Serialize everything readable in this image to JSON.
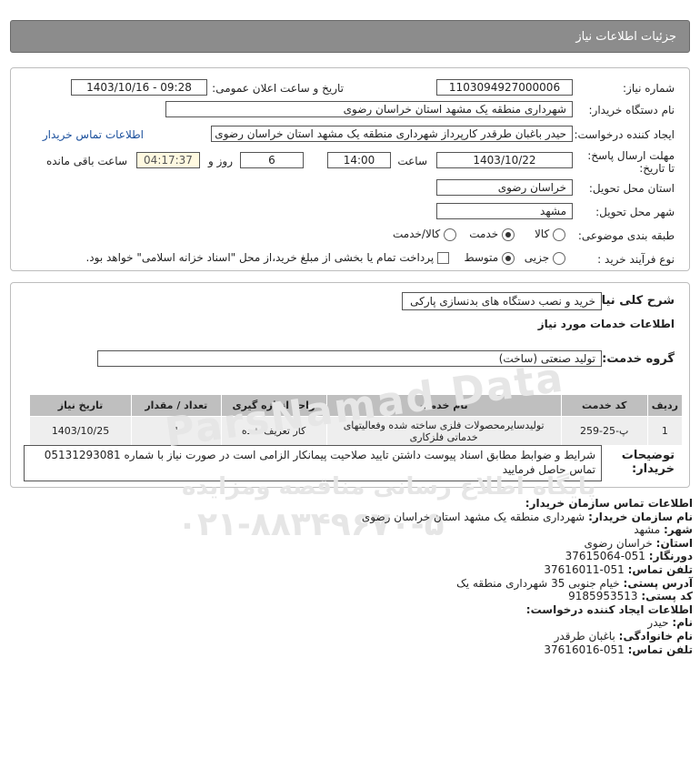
{
  "header": {
    "title": "جزئیات اطلاعات نیاز"
  },
  "info": {
    "need_number_label": "شماره نیاز:",
    "need_number": "1103094927000006",
    "announce_label": "تاریخ و ساعت اعلان عمومی:",
    "announce_value": "1403/10/16 - 09:28",
    "buyer_label": "نام دستگاه خریدار:",
    "buyer": "شهرداری منطقه یک مشهد استان خراسان رضوی",
    "creator_label": "ایجاد کننده درخواست:",
    "creator": "حیدر باغبان طرقدر کارپرداز شهرداری منطقه یک مشهد استان خراسان رضوی",
    "contact_link": "اطلاعات تماس خریدار",
    "deadline_label": "مهلت ارسال پاسخ: تا تاریخ:",
    "deadline_date": "1403/10/22",
    "time_label": "ساعت",
    "deadline_time": "14:00",
    "days_value": "6",
    "days_label": "روز و",
    "remaining_time": "04:17:37",
    "remaining_label": "ساعت باقی مانده",
    "province_label": "استان محل تحویل:",
    "province": "خراسان رضوی",
    "city_label": "شهر محل تحویل:",
    "city": "مشهد",
    "category_label": "طبقه بندی موضوعی:",
    "category_options": [
      "کالا",
      "خدمت",
      "کالا/خدمت"
    ],
    "category_selected": 1,
    "process_label": "نوع فرآیند خرید :",
    "process_options": [
      "جزیی",
      "متوسط"
    ],
    "process_selected": 1,
    "payment_note": "پرداخت تمام یا بخشی از مبلغ خرید،از محل \"اسناد خزانه اسلامی\" خواهد بود."
  },
  "details": {
    "summary_label": "شرح کلی نیاز:",
    "summary": "خرید و نصب دستگاه های بدنسازی پارکی",
    "services_heading": "اطلاعات خدمات مورد نیاز",
    "service_group_label": "گروه خدمت:",
    "service_group": "تولید صنعتی (ساخت)",
    "table": {
      "headers": [
        "ردیف",
        "کد خدمت",
        "نام خدمت",
        "واحد اندازه گیری",
        "تعداد / مقدار",
        "تاریخ نیاز"
      ],
      "rows": [
        [
          "1",
          "پ-25-259",
          "تولیدسایرمحصولات فلزی ساخته شده وفعالیتهای خدماتی فلزکاری",
          "کار تعریف شده",
          "1",
          "1403/10/25"
        ]
      ]
    },
    "buyer_notes_label": "توضیحات خریدار:",
    "buyer_notes": "شرایط و ضوابط مطابق اسناد پیوست داشتن تایید صلاحیت پیمانکار الزامی است در صورت نیاز با شماره 05131293081 تماس حاصل فرمایید"
  },
  "contact": {
    "org_heading": "اطلاعات تماس سازمان خریدار:",
    "buyer_name_label": "نام سازمان خریدار:",
    "buyer_name": "شهرداری منطقه یک مشهد استان خراسان رضوی",
    "city_label": "شهر:",
    "city": "مشهد",
    "province_label": "استان:",
    "province": "خراسان رضوی",
    "fax_label": "دورنگار:",
    "fax": "051-37615064",
    "phone_label": "تلفن تماس:",
    "phone": "051-37616011",
    "address_label": "آدرس پستی:",
    "address": "خیام جنوبی 35 شهرداری منطقه یک",
    "postal_label": "کد پستی:",
    "postal": "9185953513",
    "creator_heading": "اطلاعات ایجاد کننده درخواست:",
    "first_name_label": "نام:",
    "first_name": "حیدر",
    "last_name_label": "نام خانوادگی:",
    "last_name": "باغبان طرقدر",
    "creator_phone_label": "تلفن تماس:",
    "creator_phone": "051-37616016"
  },
  "watermark": {
    "line1": "ParsNamad Data",
    "line2": "پایگاه اطلاع رسانی مناقصه ومزایده",
    "phone": "۰۲۱-۸۸۳۴۹۶۷۰-۵"
  }
}
